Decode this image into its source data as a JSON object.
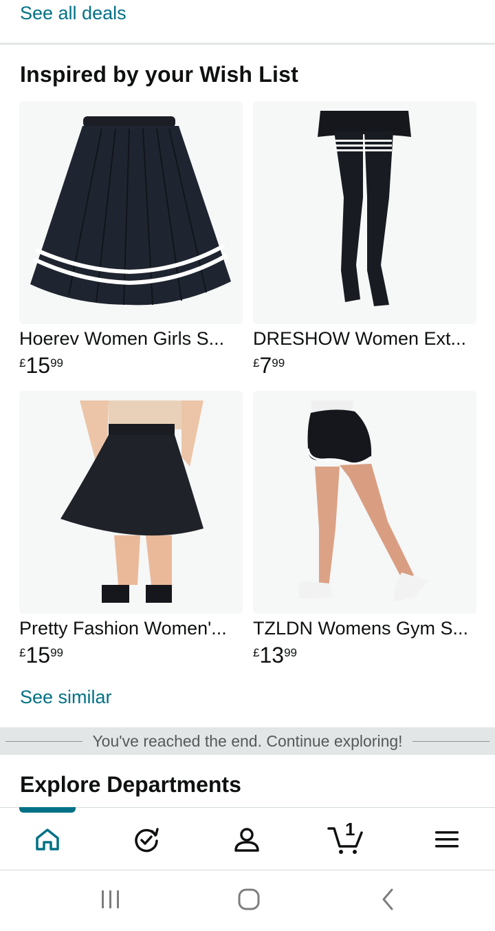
{
  "top": {
    "see_all": "See all deals"
  },
  "wishlist": {
    "title": "Inspired by your Wish List",
    "products": [
      {
        "title": "Hoerev Women Girls S...",
        "currency": "£",
        "whole": "15",
        "fraction": "99"
      },
      {
        "title": "DRESHOW Women Ext...",
        "currency": "£",
        "whole": "7",
        "fraction": "99"
      },
      {
        "title": "Pretty Fashion Women'...",
        "currency": "£",
        "whole": "15",
        "fraction": "99"
      },
      {
        "title": "TZLDN Womens Gym S...",
        "currency": "£",
        "whole": "13",
        "fraction": "99"
      }
    ],
    "see_similar": "See similar"
  },
  "end_message": "You've reached the end. Continue exploring!",
  "explore": {
    "title": "Explore Departments"
  },
  "bottom_nav": {
    "items": [
      {
        "icon": "home-icon"
      },
      {
        "icon": "refresh-icon"
      },
      {
        "icon": "account-icon"
      },
      {
        "icon": "cart-icon",
        "count": "1"
      },
      {
        "icon": "menu-icon"
      }
    ],
    "active_color": "#007185"
  },
  "colors": {
    "link": "#007185",
    "text": "#0f1111",
    "muted": "#565959"
  }
}
